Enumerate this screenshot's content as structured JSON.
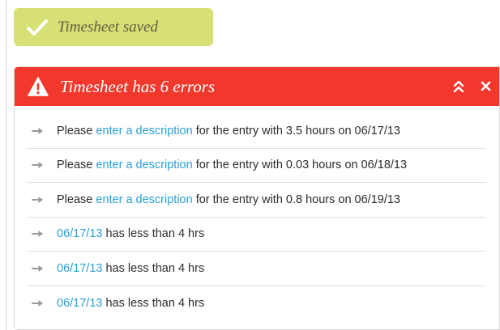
{
  "colors": {
    "toast_bg": "#d7e074",
    "error_header_bg": "#f2382d",
    "link": "#2a9fd6"
  },
  "toast": {
    "icon": "check-icon",
    "message": "Timesheet saved"
  },
  "error_panel": {
    "icon": "warning-icon",
    "title": "Timesheet has 6 errors",
    "collapse_icon": "double-chevron-up-icon",
    "close_icon": "close-icon",
    "items": [
      {
        "prefix": "Please ",
        "link": "enter a description",
        "suffix": " for the entry with 3.5 hours on 06/17/13"
      },
      {
        "prefix": "Please ",
        "link": "enter a description",
        "suffix": " for the entry with 0.03 hours on 06/18/13"
      },
      {
        "prefix": "Please ",
        "link": "enter a description",
        "suffix": " for the entry with 0.8 hours on 06/19/13"
      },
      {
        "prefix": "",
        "link": "06/17/13",
        "suffix": " has less than 4 hrs"
      },
      {
        "prefix": "",
        "link": "06/17/13",
        "suffix": " has less than 4 hrs"
      },
      {
        "prefix": "",
        "link": "06/17/13",
        "suffix": " has less than 4 hrs"
      }
    ]
  }
}
